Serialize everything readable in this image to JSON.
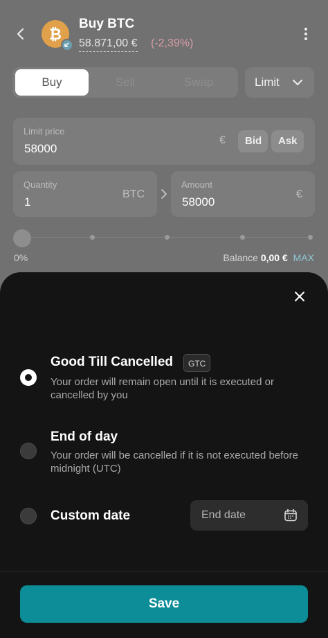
{
  "header": {
    "title": "Buy BTC",
    "price": "58.871,00 €",
    "change": "(-2,39%)",
    "coin_icon": "bitcoin-icon"
  },
  "tabs": [
    {
      "label": "Buy",
      "active": true
    },
    {
      "label": "Sell",
      "active": false
    },
    {
      "label": "Swap",
      "active": false
    }
  ],
  "order_type": {
    "label": "Limit"
  },
  "limit_price": {
    "label": "Limit price",
    "value": "58000",
    "currency": "€",
    "bid": "Bid",
    "ask": "Ask"
  },
  "quantity": {
    "label": "Quantity",
    "value": "1",
    "unit": "BTC"
  },
  "amount": {
    "label": "Amount",
    "value": "58000",
    "currency": "€"
  },
  "slider": {
    "percent_label": "0%",
    "fraction": 0
  },
  "balance": {
    "label": "Balance",
    "value": "0,00 €",
    "max": "MAX"
  },
  "sheet": {
    "options": [
      {
        "title": "Good Till Cancelled",
        "badge": "GTC",
        "description": "Your order will remain open until it is executed or cancelled by you",
        "selected": true
      },
      {
        "title": "End of day",
        "description": "Your order will be cancelled if it is not executed before midnight (UTC)",
        "selected": false
      },
      {
        "title": "Custom date",
        "selected": false
      }
    ],
    "end_date_placeholder": "End date",
    "save_label": "Save"
  },
  "colors": {
    "accent": "#0d8d98",
    "sheet_bg": "#141414",
    "negative": "#d79ca5",
    "bitcoin": "#e0a14a"
  }
}
